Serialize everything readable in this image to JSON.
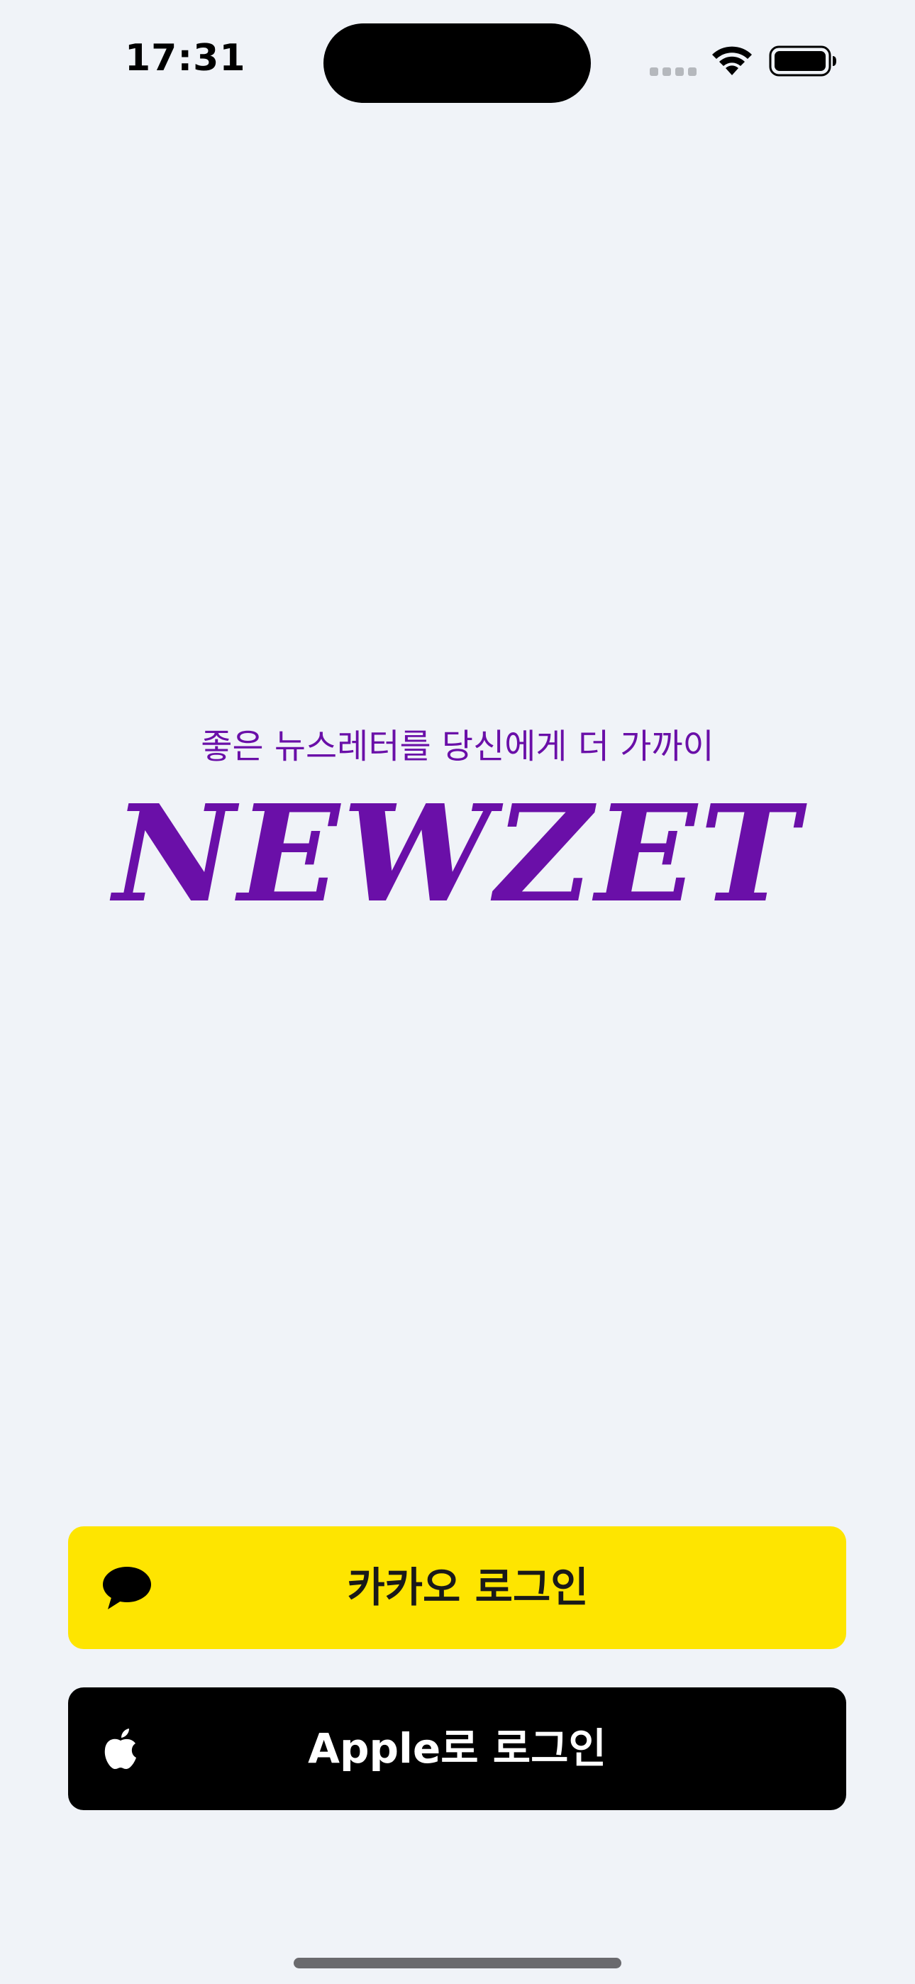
{
  "status_bar": {
    "time": "17:31",
    "signal_icon": "cellular-signal-icon",
    "wifi_icon": "wifi-icon",
    "battery_icon": "battery-icon"
  },
  "splash": {
    "tagline": "좋은 뉴스레터를 당신에게 더 가까이",
    "logo_text": "NEWZET"
  },
  "login": {
    "kakao_label": "카카오 로그인",
    "kakao_icon": "kakao-speech-bubble-icon",
    "apple_label": "Apple로 로그인",
    "apple_icon": "apple-logo-icon"
  },
  "colors": {
    "background": "#f0f3f8",
    "brand_purple": "#6a0fa8",
    "kakao_yellow": "#fee500",
    "apple_black": "#000000"
  }
}
